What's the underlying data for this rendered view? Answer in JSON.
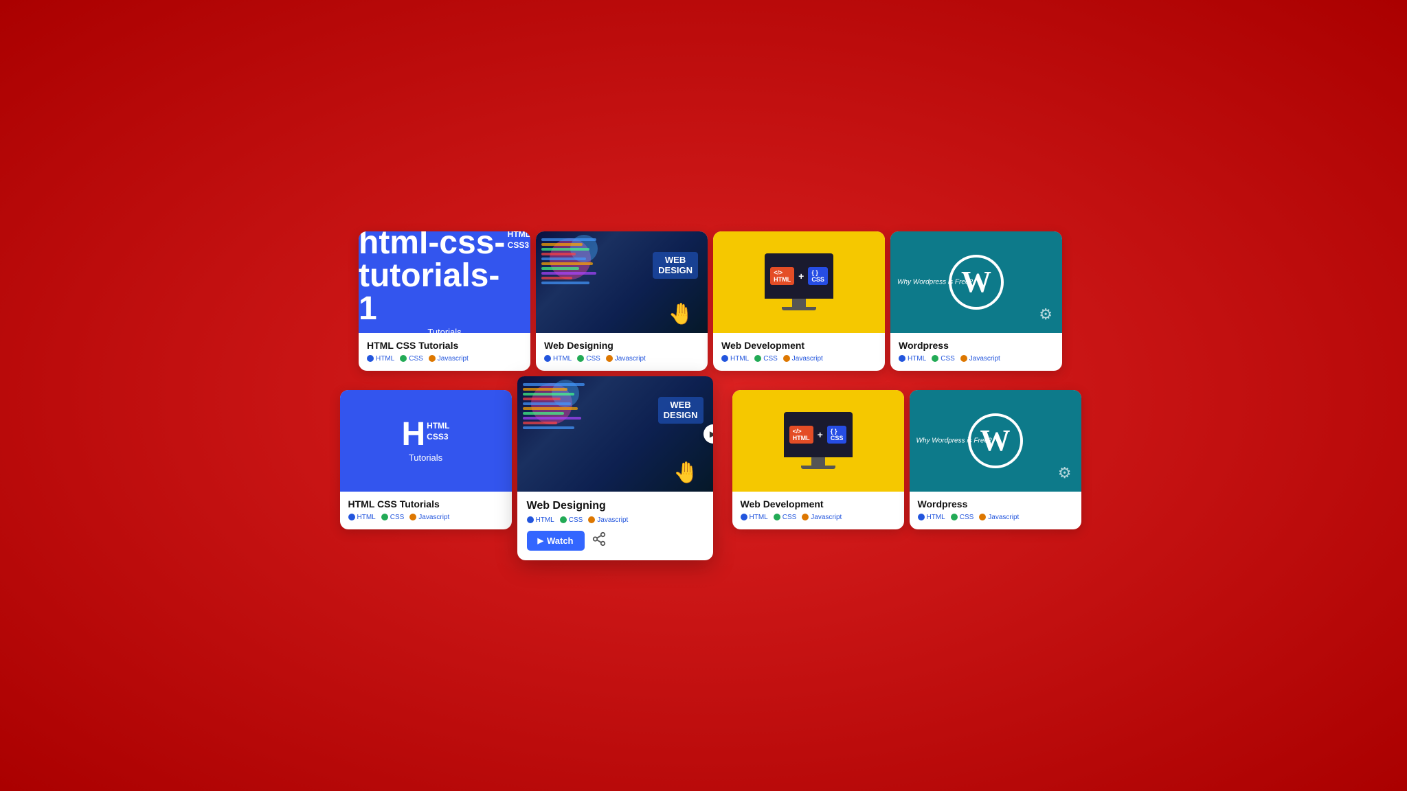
{
  "page": {
    "bg_color": "#cc0000"
  },
  "rows": [
    {
      "cards": [
        {
          "id": "html-css-tutorials-1",
          "type": "html-tutorials",
          "title": "HTML CSS Tutorials",
          "tags": [
            {
              "label": "HTML",
              "dot": "blue"
            },
            {
              "label": "CSS",
              "dot": "green"
            },
            {
              "label": "Javascript",
              "dot": "orange"
            }
          ]
        },
        {
          "id": "web-designing-1",
          "type": "web-designing",
          "title": "Web Designing",
          "tags": [
            {
              "label": "HTML",
              "dot": "blue"
            },
            {
              "label": "CSS",
              "dot": "green"
            },
            {
              "label": "Javascript",
              "dot": "orange"
            }
          ]
        },
        {
          "id": "web-development-1",
          "type": "web-development",
          "title": "Web Development",
          "tags": [
            {
              "label": "HTML",
              "dot": "blue"
            },
            {
              "label": "CSS",
              "dot": "green"
            },
            {
              "label": "Javascript",
              "dot": "orange"
            }
          ]
        },
        {
          "id": "wordpress-1",
          "type": "wordpress",
          "title": "Wordpress",
          "tags": [
            {
              "label": "HTML",
              "dot": "blue"
            },
            {
              "label": "CSS",
              "dot": "green"
            },
            {
              "label": "Javascript",
              "dot": "orange"
            }
          ]
        }
      ]
    },
    {
      "cards": [
        {
          "id": "html-css-tutorials-2",
          "type": "html-tutorials",
          "title": "HTML CSS Tutorials",
          "tags": [
            {
              "label": "HTML",
              "dot": "blue"
            },
            {
              "label": "CSS",
              "dot": "green"
            },
            {
              "label": "Javascript",
              "dot": "orange"
            }
          ]
        },
        {
          "id": "web-designing-2",
          "type": "web-designing",
          "title": "Web Designing",
          "expanded": true,
          "tags": [
            {
              "label": "HTML",
              "dot": "blue"
            },
            {
              "label": "CSS",
              "dot": "green"
            },
            {
              "label": "Javascript",
              "dot": "orange"
            }
          ],
          "watch_label": "Watch",
          "share_label": "Share"
        },
        {
          "id": "web-development-2",
          "type": "web-development",
          "title": "Web Development",
          "tags": [
            {
              "label": "HTML",
              "dot": "blue"
            },
            {
              "label": "CSS",
              "dot": "green"
            },
            {
              "label": "Javascript",
              "dot": "orange"
            }
          ]
        },
        {
          "id": "wordpress-2",
          "type": "wordpress",
          "title": "Wordpress",
          "tags": [
            {
              "label": "HTML",
              "dot": "blue"
            },
            {
              "label": "CSS",
              "dot": "green"
            },
            {
              "label": "Javascript",
              "dot": "orange"
            }
          ]
        }
      ]
    }
  ]
}
